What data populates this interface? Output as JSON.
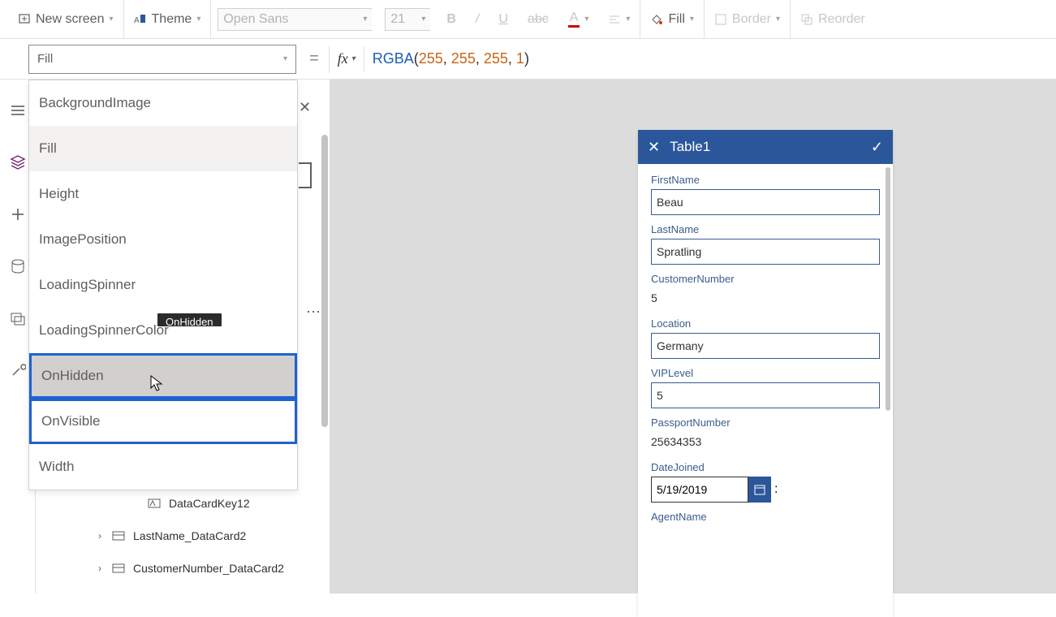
{
  "toolbar": {
    "new_screen": "New screen",
    "theme": "Theme",
    "font": "Open Sans",
    "size": "21",
    "fill": "Fill",
    "border": "Border",
    "reorder": "Reorder"
  },
  "formula": {
    "property": "Fill",
    "fn": "RGBA",
    "args": [
      "255",
      "255",
      "255",
      "1"
    ]
  },
  "dropdown": {
    "items": [
      "BackgroundImage",
      "Fill",
      "Height",
      "ImagePosition",
      "LoadingSpinner",
      "LoadingSpinnerColor",
      "OnHidden",
      "OnVisible",
      "Width"
    ]
  },
  "tree": {
    "row1": "DataCardKey12",
    "row2": "LastName_DataCard2",
    "row3": "CustomerNumber_DataCard2"
  },
  "phone": {
    "title": "Table1",
    "fields": {
      "firstname_label": "FirstName",
      "firstname": "Beau",
      "lastname_label": "LastName",
      "lastname": "Spratling",
      "custno_label": "CustomerNumber",
      "custno": "5",
      "location_label": "Location",
      "location": "Germany",
      "vip_label": "VIPLevel",
      "vip": "5",
      "passport_label": "PassportNumber",
      "passport": "25634353",
      "datejoined_label": "DateJoined",
      "datejoined": "5/19/2019",
      "agent_label": "AgentName"
    }
  },
  "tooltip": "OnHidden"
}
